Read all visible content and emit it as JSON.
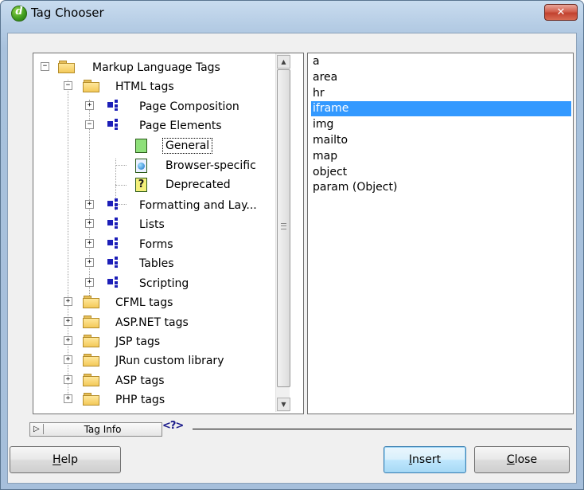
{
  "window": {
    "title": "Tag Chooser",
    "close_glyph": "✕"
  },
  "tree": {
    "root": "Markup Language Tags",
    "html_tags": "HTML tags",
    "page_composition": "Page Composition",
    "page_elements": "Page Elements",
    "general": "General",
    "browser_specific": "Browser-specific",
    "deprecated": "Deprecated",
    "formatting": "Formatting and Lay...",
    "lists": "Lists",
    "forms": "Forms",
    "tables": "Tables",
    "scripting": "Scripting",
    "cfml": "CFML tags",
    "aspnet": "ASP.NET tags",
    "jsp": "JSP tags",
    "jrun": "JRun custom library",
    "asp": "ASP tags",
    "php": "PHP tags",
    "expand": "+",
    "collapse": "−"
  },
  "tags": [
    "a",
    "area",
    "hr",
    "iframe",
    "img",
    "mailto",
    "map",
    "object",
    "param (Object)"
  ],
  "selected_tag": "iframe",
  "tag_info": {
    "label": "Tag Info",
    "help_glyph": "<?>"
  },
  "buttons": {
    "help": "Help",
    "insert": "Insert",
    "close": "Close"
  },
  "colors": {
    "selection": "#3399ff",
    "title_close": "#c2422f",
    "folder": "#f3c95a"
  }
}
